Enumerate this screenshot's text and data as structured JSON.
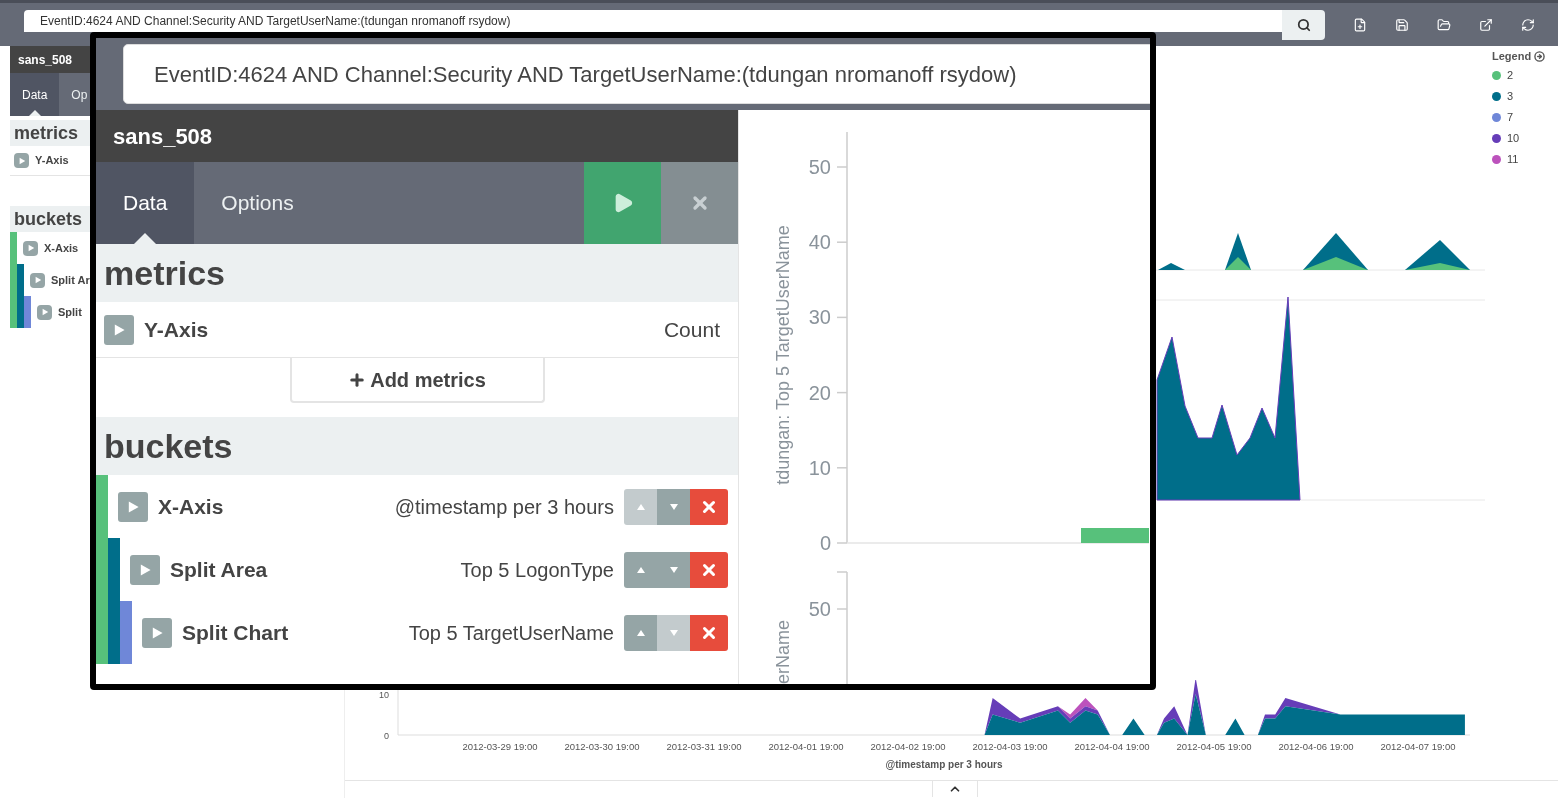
{
  "toolbar": {
    "query": "EventID:4624 AND Channel:Security AND TargetUserName:(tdungan nromanoff rsydow)"
  },
  "editor": {
    "index": "sans_508",
    "tabs": [
      {
        "label": "Data",
        "selected": true
      },
      {
        "label": "Op",
        "selected": false
      }
    ],
    "metrics_heading": "metrics",
    "metrics": [
      {
        "label": "Y-Axis"
      }
    ],
    "buckets_heading": "buckets",
    "buckets": [
      {
        "label": "X-Axis",
        "color": "#57c17b",
        "children": [
          {
            "label": "Split Ar",
            "color": "#006e8a",
            "children": [
              {
                "label": "Split",
                "color": "#6f87d8"
              }
            ]
          }
        ]
      }
    ]
  },
  "legend": {
    "title": "Legend",
    "items": [
      {
        "label": "2",
        "color": "#57c17b"
      },
      {
        "label": "3",
        "color": "#006e8a"
      },
      {
        "label": "7",
        "color": "#6f87d8"
      },
      {
        "label": "10",
        "color": "#663db8"
      },
      {
        "label": "11",
        "color": "#bc52bc"
      }
    ]
  },
  "chart": {
    "y_ticks": [
      "10",
      "0"
    ],
    "x_ticks": [
      "2012-03-29 19:00",
      "2012-03-30 19:00",
      "2012-03-31 19:00",
      "2012-04-01 19:00",
      "2012-04-02 19:00",
      "2012-04-03 19:00",
      "2012-04-04 19:00",
      "2012-04-05 19:00",
      "2012-04-06 19:00",
      "2012-04-07 19:00"
    ],
    "x_title": "@timestamp per 3 hours"
  },
  "inset": {
    "query": "EventID:4624 AND Channel:Security AND TargetUserName:(tdungan nromanoff rsydow)",
    "index": "sans_508",
    "tabs": [
      {
        "label": "Data",
        "selected": true
      },
      {
        "label": "Options",
        "selected": false
      }
    ],
    "metrics_heading": "metrics",
    "metrics": [
      {
        "label": "Y-Axis",
        "value": "Count"
      }
    ],
    "add_metrics": "Add metrics",
    "buckets_heading": "buckets",
    "buckets": [
      {
        "label": "X-Axis",
        "value": "@timestamp per 3 hours",
        "color": "#57c17b",
        "up_disabled": true,
        "down_disabled": false,
        "children": [
          {
            "label": "Split Area",
            "value": "Top 5 LogonType",
            "color": "#006e8a",
            "up_disabled": false,
            "down_disabled": false,
            "children": [
              {
                "label": "Split Chart",
                "value": "Top 5 TargetUserName",
                "color": "#6f87d8",
                "up_disabled": false,
                "down_disabled": true
              }
            ]
          }
        ]
      }
    ],
    "chart": {
      "y_title": "tdungan: Top 5 TargetUserName",
      "y_ticks": [
        "50",
        "40",
        "30",
        "20",
        "10",
        "0"
      ]
    },
    "chart_2": {
      "ylabel": "erName",
      "tick": "50"
    }
  }
}
